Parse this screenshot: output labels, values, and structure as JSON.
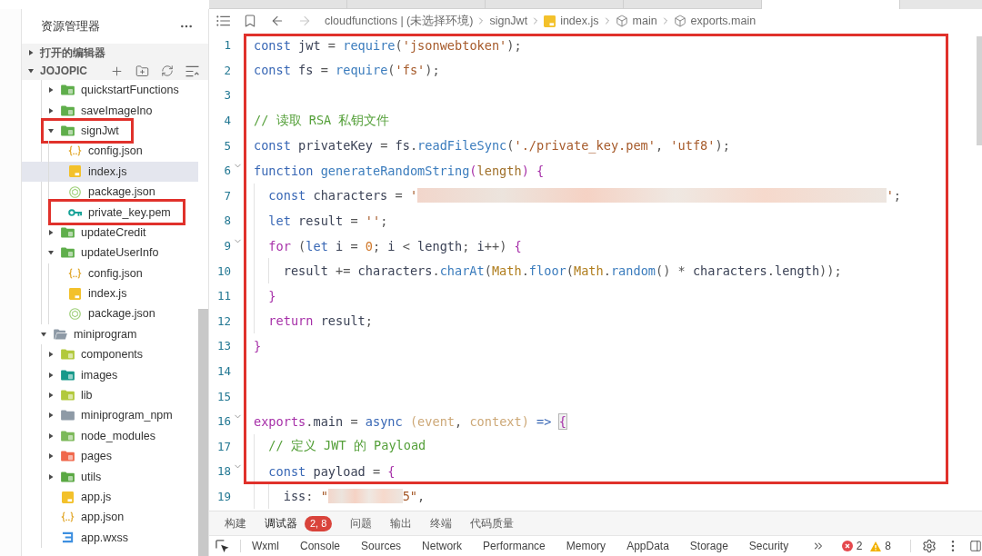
{
  "tab_strip": {
    "tabs": [
      {
        "selected": false
      },
      {
        "selected": false
      },
      {
        "selected": false
      },
      {
        "selected": false
      },
      {
        "selected": true
      }
    ]
  },
  "sidebar": {
    "title": "资源管理器",
    "sections": [
      {
        "label": "打开的编辑器",
        "expanded": false
      },
      {
        "label": "JOJOPIC",
        "expanded": true,
        "actions": [
          {
            "kind": "new_file"
          },
          {
            "kind": "new_folder"
          },
          {
            "kind": "refresh"
          },
          {
            "kind": "collapse"
          }
        ],
        "tree": [
          {
            "children": [
              {
                "label": "quickstartFunctions",
                "kind": "folder",
                "color": "#5fae4b",
                "expanded": false,
                "selected": false,
                "annotated": false
              },
              {
                "label": "saveImageIno",
                "kind": "folder",
                "color": "#5fae4b",
                "expanded": false,
                "selected": false,
                "annotated": false
              },
              {
                "label": "signJwt",
                "kind": "folder",
                "color": "#5fae4b",
                "expanded": true,
                "selected": false,
                "annotated": true,
                "children": [
                  {
                    "label": "config.json",
                    "kind": "json",
                    "selected": false,
                    "annotated": false
                  },
                  {
                    "label": "index.js",
                    "kind": "js",
                    "selected": true,
                    "annotated": false
                  },
                  {
                    "label": "package.json",
                    "kind": "package",
                    "selected": false,
                    "annotated": false
                  },
                  {
                    "label": "private_key.pem",
                    "kind": "key",
                    "selected": false,
                    "annotated": true
                  }
                ]
              },
              {
                "label": "updateCredit",
                "kind": "folder",
                "color": "#5fae4b",
                "expanded": false,
                "selected": false,
                "annotated": false
              },
              {
                "label": "updateUserInfo",
                "kind": "folder",
                "color": "#5fae4b",
                "expanded": true,
                "selected": false,
                "annotated": false,
                "children": [
                  {
                    "label": "config.json",
                    "kind": "json",
                    "selected": false,
                    "annotated": false
                  },
                  {
                    "label": "index.js",
                    "kind": "js",
                    "selected": false,
                    "annotated": false
                  },
                  {
                    "label": "package.json",
                    "kind": "package",
                    "selected": false,
                    "annotated": false
                  }
                ]
              }
            ]
          },
          {
            "label": "miniprogram",
            "kind": "folder_open",
            "color": "#8e9aa6",
            "expanded": true,
            "selected": false,
            "annotated": false,
            "children": [
              {
                "label": "components",
                "kind": "folder",
                "color": "#b2c93c",
                "expanded": false,
                "selected": false,
                "annotated": false
              },
              {
                "label": "images",
                "kind": "folder",
                "color": "#17998a",
                "expanded": false,
                "selected": false,
                "annotated": false
              },
              {
                "label": "lib",
                "kind": "folder",
                "color": "#b2c93c",
                "expanded": false,
                "selected": false,
                "annotated": false
              },
              {
                "label": "miniprogram_npm",
                "kind": "folder_plain",
                "color": "#8e9aa6",
                "expanded": false,
                "selected": false,
                "annotated": false
              },
              {
                "label": "node_modules",
                "kind": "folder",
                "color": "#7cb95a",
                "expanded": false,
                "selected": false,
                "annotated": false
              },
              {
                "label": "pages",
                "kind": "folder",
                "color": "#f0674b",
                "expanded": false,
                "selected": false,
                "annotated": false
              },
              {
                "label": "utils",
                "kind": "folder",
                "color": "#5aa843",
                "expanded": false,
                "selected": false,
                "annotated": false
              },
              {
                "label": "app.js",
                "kind": "js",
                "selected": false,
                "annotated": false
              },
              {
                "label": "app.json",
                "kind": "json",
                "selected": false,
                "annotated": false
              },
              {
                "label": "app.wxss",
                "kind": "css",
                "selected": false,
                "annotated": false
              }
            ]
          }
        ]
      }
    ]
  },
  "breadcrumb": {
    "tools": [
      {
        "kind": "outline"
      },
      {
        "kind": "bookmark"
      },
      {
        "kind": "back",
        "disabled": false
      },
      {
        "kind": "forward",
        "disabled": true
      }
    ],
    "path": [
      {
        "text": "cloudfunctions | (未选择环境)",
        "kind": "plain"
      },
      {
        "text": "signJwt",
        "kind": "plain"
      },
      {
        "text": "index.js",
        "kind": "js"
      },
      {
        "text": "main",
        "kind": "symbol"
      },
      {
        "text": "exports.main",
        "kind": "symbol"
      }
    ]
  },
  "editor": {
    "blocks": [
      {
        "framed": true,
        "lines": [
          {
            "number": "1",
            "foldable": false,
            "tokens": [
              {
                "kind": "keyword",
                "text": "const"
              },
              {
                "kind": "ident",
                "text": " jwt"
              },
              {
                "kind": "punct",
                "text": " = "
              },
              {
                "kind": "func",
                "text": "require"
              },
              {
                "kind": "punct",
                "text": "("
              },
              {
                "kind": "string",
                "text": "'jsonwebtoken'"
              },
              {
                "kind": "punct",
                "text": ");"
              }
            ]
          },
          {
            "number": "2",
            "foldable": false,
            "tokens": [
              {
                "kind": "keyword",
                "text": "const"
              },
              {
                "kind": "ident",
                "text": " fs"
              },
              {
                "kind": "punct",
                "text": " = "
              },
              {
                "kind": "func",
                "text": "require"
              },
              {
                "kind": "punct",
                "text": "("
              },
              {
                "kind": "string",
                "text": "'fs'"
              },
              {
                "kind": "punct",
                "text": ");"
              }
            ]
          },
          {
            "number": "3",
            "foldable": false
          },
          {
            "number": "4",
            "foldable": false,
            "tokens": [
              {
                "kind": "comment",
                "text": "// 读取 RSA 私钥文件"
              }
            ]
          },
          {
            "number": "5",
            "foldable": false,
            "tokens": [
              {
                "kind": "keyword",
                "text": "const"
              },
              {
                "kind": "ident",
                "text": " privateKey"
              },
              {
                "kind": "punct",
                "text": " = "
              },
              {
                "kind": "ident",
                "text": "fs"
              },
              {
                "kind": "punct",
                "text": "."
              },
              {
                "kind": "func",
                "text": "readFileSync"
              },
              {
                "kind": "punct",
                "text": "("
              },
              {
                "kind": "string",
                "text": "'./private_key.pem'"
              },
              {
                "kind": "punct",
                "text": ", "
              },
              {
                "kind": "string",
                "text": "'utf8'"
              },
              {
                "kind": "punct",
                "text": ");"
              }
            ]
          },
          {
            "number": "6",
            "foldable": true,
            "tokens": [
              {
                "kind": "keyword",
                "text": "function"
              },
              {
                "kind": "func",
                "text": " generateRandomString"
              },
              {
                "kind": "brace",
                "text": "("
              },
              {
                "kind": "param",
                "text": "length"
              },
              {
                "kind": "brace",
                "text": ") {"
              }
            ]
          },
          {
            "number": "7",
            "foldable": false,
            "tokens": [
              {
                "kind": "keyword",
                "text": "  const"
              },
              {
                "kind": "ident",
                "text": " characters"
              },
              {
                "kind": "punct",
                "text": " = "
              },
              {
                "kind": "string",
                "text": "'"
              },
              {
                "kind": "redacted_long"
              },
              {
                "kind": "string",
                "text": "'"
              },
              {
                "kind": "punct",
                "text": ";"
              }
            ]
          },
          {
            "number": "8",
            "foldable": false,
            "tokens": [
              {
                "kind": "keyword",
                "text": "  let"
              },
              {
                "kind": "ident",
                "text": " result"
              },
              {
                "kind": "punct",
                "text": " = "
              },
              {
                "kind": "string",
                "text": "''"
              },
              {
                "kind": "punct",
                "text": ";"
              }
            ]
          },
          {
            "number": "9",
            "foldable": true,
            "tokens": [
              {
                "kind": "control",
                "text": "  for"
              },
              {
                "kind": "punct",
                "text": " ("
              },
              {
                "kind": "keyword",
                "text": "let"
              },
              {
                "kind": "ident",
                "text": " i"
              },
              {
                "kind": "punct",
                "text": " = "
              },
              {
                "kind": "number",
                "text": "0"
              },
              {
                "kind": "punct",
                "text": "; "
              },
              {
                "kind": "ident",
                "text": "i"
              },
              {
                "kind": "punct",
                "text": " < "
              },
              {
                "kind": "ident",
                "text": "length"
              },
              {
                "kind": "punct",
                "text": "; "
              },
              {
                "kind": "ident",
                "text": "i"
              },
              {
                "kind": "punct",
                "text": "++) "
              },
              {
                "kind": "brace",
                "text": "{"
              }
            ]
          },
          {
            "number": "10",
            "foldable": false,
            "tokens": [
              {
                "kind": "ident",
                "text": "    result"
              },
              {
                "kind": "punct",
                "text": " += "
              },
              {
                "kind": "ident",
                "text": "characters"
              },
              {
                "kind": "punct",
                "text": "."
              },
              {
                "kind": "func",
                "text": "charAt"
              },
              {
                "kind": "punct",
                "text": "("
              },
              {
                "kind": "class",
                "text": "Math"
              },
              {
                "kind": "punct",
                "text": "."
              },
              {
                "kind": "func",
                "text": "floor"
              },
              {
                "kind": "punct",
                "text": "("
              },
              {
                "kind": "class",
                "text": "Math"
              },
              {
                "kind": "punct",
                "text": "."
              },
              {
                "kind": "func",
                "text": "random"
              },
              {
                "kind": "punct",
                "text": "() * "
              },
              {
                "kind": "ident",
                "text": "characters"
              },
              {
                "kind": "punct",
                "text": "."
              },
              {
                "kind": "ident",
                "text": "length"
              },
              {
                "kind": "punct",
                "text": "));"
              }
            ]
          },
          {
            "number": "11",
            "foldable": false,
            "tokens": [
              {
                "kind": "brace",
                "text": "  }"
              }
            ]
          },
          {
            "number": "12",
            "foldable": false,
            "tokens": [
              {
                "kind": "control",
                "text": "  return"
              },
              {
                "kind": "ident",
                "text": " result"
              },
              {
                "kind": "punct",
                "text": ";"
              }
            ]
          },
          {
            "number": "13",
            "foldable": false,
            "tokens": [
              {
                "kind": "brace",
                "text": "}"
              }
            ]
          },
          {
            "number": "14",
            "foldable": false
          },
          {
            "number": "15",
            "foldable": false
          },
          {
            "number": "16",
            "foldable": true,
            "tokens": [
              {
                "kind": "control",
                "text": "exports"
              },
              {
                "kind": "punct",
                "text": "."
              },
              {
                "kind": "ident",
                "text": "main"
              },
              {
                "kind": "punct",
                "text": " = "
              },
              {
                "kind": "keyword",
                "text": "async"
              },
              {
                "kind": "param_dim",
                "text": " (event"
              },
              {
                "kind": "punct",
                "text": ", "
              },
              {
                "kind": "param_dim",
                "text": "context)"
              },
              {
                "kind": "keyword",
                "text": " => "
              },
              {
                "kind": "bracket_match",
                "text": "{"
              }
            ]
          },
          {
            "number": "17",
            "foldable": false,
            "tokens": [
              {
                "kind": "comment",
                "text": "  // 定义 JWT 的 Payload"
              }
            ]
          },
          {
            "number": "18",
            "foldable": true,
            "tokens": [
              {
                "kind": "keyword",
                "text": "  const"
              },
              {
                "kind": "ident",
                "text": " payload"
              },
              {
                "kind": "punct",
                "text": " = "
              },
              {
                "kind": "brace",
                "text": "{"
              }
            ]
          }
        ]
      },
      {
        "framed": false,
        "lines": [
          {
            "number": "19",
            "foldable": false,
            "tokens": [
              {
                "kind": "ident",
                "text": "    iss"
              },
              {
                "kind": "punct",
                "text": ": "
              },
              {
                "kind": "string",
                "text": "\""
              },
              {
                "kind": "redacted_short"
              },
              {
                "kind": "string",
                "text": "5\""
              },
              {
                "kind": "punct",
                "text": ","
              }
            ]
          }
        ]
      }
    ]
  },
  "panel": {
    "tabs": [
      {
        "label": "构建",
        "selected": false
      },
      {
        "label": "调试器",
        "selected": true,
        "badge": "2, 8"
      },
      {
        "label": "问题",
        "selected": false
      },
      {
        "label": "输出",
        "selected": false
      },
      {
        "label": "终端",
        "selected": false
      },
      {
        "label": "代码质量",
        "selected": false
      }
    ],
    "devtools": {
      "tabs": [
        "Wxml",
        "Console",
        "Sources",
        "Network",
        "Performance",
        "Memory",
        "AppData",
        "Storage",
        "Security"
      ],
      "errors": "2",
      "warnings": "8"
    }
  }
}
